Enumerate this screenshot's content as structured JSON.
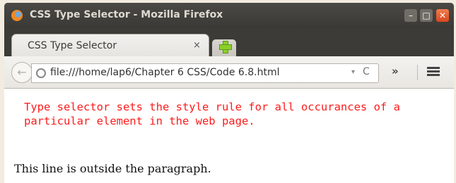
{
  "window": {
    "title": "CSS Type Selector - Mozilla Firefox",
    "controls": {
      "minimize": "–",
      "maximize": "□",
      "close": "✕"
    }
  },
  "tabs": [
    {
      "label": "CSS Type Selector",
      "close": "×"
    }
  ],
  "navbar": {
    "back": "←",
    "url": "file:///home/lap6/Chapter 6 CSS/Code 6.8.html",
    "dropdown": "▾",
    "reload": "C",
    "overflow": "»"
  },
  "content": {
    "paragraph": "Type selector sets the style rule for all occurances of a particular element in the web page.",
    "outside_line": "This line is outside the paragraph."
  },
  "colors": {
    "paragraph_text": "#ff1a1a",
    "titlebar": "#3c3b37"
  },
  "icons": [
    "firefox-logo-icon",
    "new-tab-plus-icon",
    "globe-icon",
    "reload-icon",
    "menu-icon"
  ]
}
